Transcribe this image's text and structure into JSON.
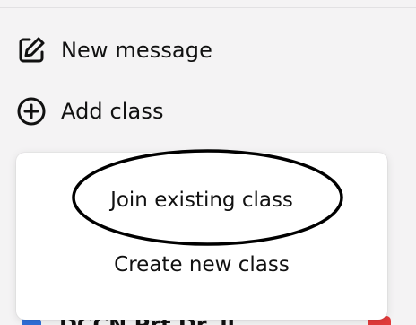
{
  "sidebar": {
    "new_message": {
      "label": "New message",
      "icon": "compose-icon"
    },
    "add_class": {
      "label": "Add class",
      "icon": "plus-circle-icon"
    },
    "partial_item": {
      "title": "DCCN Prt Dr..ll"
    }
  },
  "add_class_menu": {
    "options": [
      {
        "label": "Join existing class"
      },
      {
        "label": "Create new class"
      }
    ],
    "highlighted_option": "Join existing class"
  },
  "colors": {
    "background": "#f4f3f4",
    "menu_background": "#ffffff",
    "text": "#111111",
    "annotation": "#000000",
    "badge_blue": "#2f6fd8",
    "badge_red": "#e23b3b"
  }
}
